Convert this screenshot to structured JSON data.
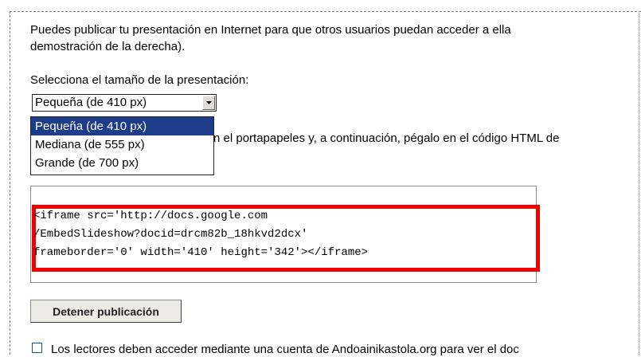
{
  "intro": {
    "line1": "Puedes publicar tu presentación en Internet para que otros usuarios puedan acceder a ella",
    "line2": "demostración de la derecha)."
  },
  "size_label": "Selecciona el tamaño de la presentación:",
  "size_select": {
    "selected": "Pequeña (de 410 px)",
    "options": [
      "Pequeña (de 410 px)",
      "Mediana (de 555 px)",
      "Grande (de 700 px)"
    ]
  },
  "copy_instruction": "n el portapapeles y, a continuación, pégalo en el código HTML de",
  "embed_code": {
    "line1": "<iframe src='http://docs.google.com",
    "line2": "/EmbedSlideshow?docid=drcm82b_18hkvd2dcx'",
    "line3": "frameborder='0' width='410' height='342'></iframe>"
  },
  "stop_button_label": "Detener publicación",
  "access_checkbox": {
    "label": "Los lectores deben acceder mediante una cuenta de Andoainikastola.org para ver el doc",
    "checked": false
  },
  "colors": {
    "highlight": "#ee0000",
    "selection": "#1d3c8a"
  }
}
